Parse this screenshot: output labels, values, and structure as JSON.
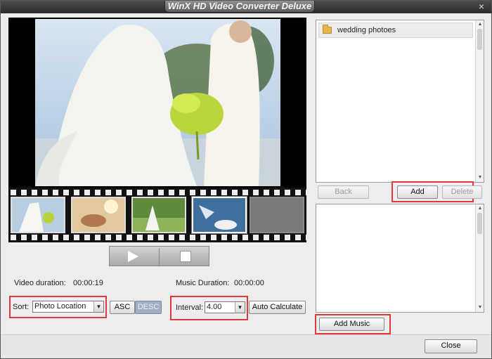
{
  "window": {
    "title": "WinX HD Video Converter Deluxe",
    "close_glyph": "×"
  },
  "preview": {
    "play_icon": "play-icon",
    "stop_icon": "stop-icon",
    "thumbnails": [
      "wedding-photo-1",
      "wedding-photo-2",
      "wedding-photo-3",
      "wedding-photo-4",
      "empty"
    ]
  },
  "info": {
    "video_duration_label": "Video duration:",
    "video_duration_value": "00:00:19",
    "music_duration_label": "Music Duration:",
    "music_duration_value": "00:00:00"
  },
  "sort": {
    "label": "Sort:",
    "selected": "Photo Location",
    "asc_label": "ASC",
    "desc_label": "DESC"
  },
  "interval": {
    "label": "Interval:",
    "selected": "4.00",
    "auto_label": "Auto Calculate"
  },
  "photo_panel": {
    "folder_name": "wedding photoes",
    "back_label": "Back",
    "add_label": "Add",
    "delete_label": "Delete"
  },
  "music_panel": {
    "add_music_label": "Add Music"
  },
  "footer": {
    "close_label": "Close"
  },
  "colors": {
    "highlight": "#e0393e",
    "title_bar": "#3a3a3a"
  }
}
